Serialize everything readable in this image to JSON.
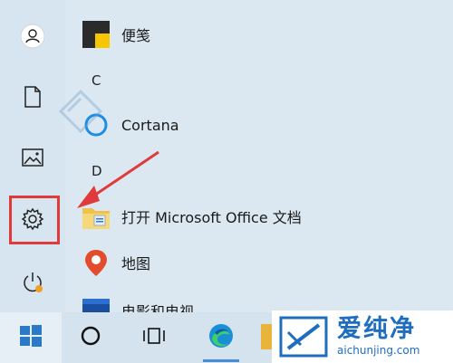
{
  "sections": {
    "c_letter": "C",
    "d_letter": "D"
  },
  "apps": [
    {
      "label": "便笺",
      "icon": "sticky-notes-icon"
    },
    {
      "label": "Cortana",
      "icon": "cortana-icon"
    },
    {
      "label": "打开 Microsoft Office 文档",
      "icon": "office-folder-icon"
    },
    {
      "label": "地图",
      "icon": "maps-icon"
    },
    {
      "label": "电影和电视",
      "icon": "movies-tv-icon"
    }
  ],
  "rail": [
    "user-icon",
    "documents-icon",
    "pictures-icon",
    "settings-icon",
    "power-icon"
  ],
  "taskbar": [
    "start-icon",
    "cortana-icon",
    "task-view-icon",
    "edge-icon",
    "file-explorer-icon"
  ],
  "watermark": {
    "cn": "爱纯净",
    "url": "aichunjing.com"
  },
  "colors": {
    "highlight": "#e03a3a",
    "accent": "#1f6dbf"
  }
}
